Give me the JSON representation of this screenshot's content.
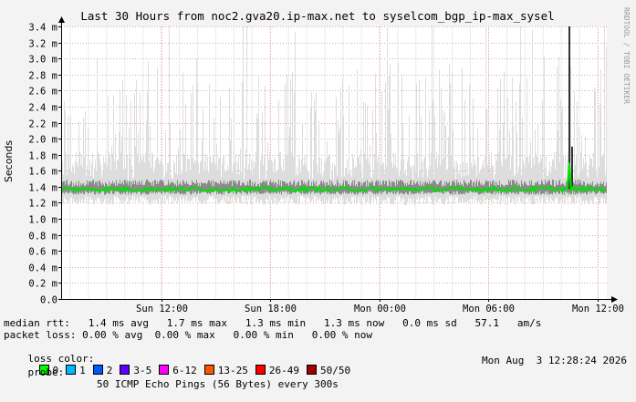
{
  "chart_data": {
    "type": "line",
    "title": "Last 30 Hours from noc2.gva20.ip-max.net to syselcom_bgp_ip-max_sysel",
    "ylabel": "Seconds",
    "watermark": "RRDTOOL / TOBI OETIKER",
    "ylim": [
      0,
      3.4
    ],
    "yticks": [
      {
        "v": 0.0,
        "label": "0.0"
      },
      {
        "v": 0.2,
        "label": "0.2 m"
      },
      {
        "v": 0.4,
        "label": "0.4 m"
      },
      {
        "v": 0.6,
        "label": "0.6 m"
      },
      {
        "v": 0.8,
        "label": "0.8 m"
      },
      {
        "v": 1.0,
        "label": "1.0 m"
      },
      {
        "v": 1.2,
        "label": "1.2 m"
      },
      {
        "v": 1.4,
        "label": "1.4 m"
      },
      {
        "v": 1.6,
        "label": "1.6 m"
      },
      {
        "v": 1.8,
        "label": "1.8 m"
      },
      {
        "v": 2.0,
        "label": "2.0 m"
      },
      {
        "v": 2.2,
        "label": "2.2 m"
      },
      {
        "v": 2.4,
        "label": "2.4 m"
      },
      {
        "v": 2.6,
        "label": "2.6 m"
      },
      {
        "v": 2.8,
        "label": "2.8 m"
      },
      {
        "v": 3.0,
        "label": "3.0 m"
      },
      {
        "v": 3.2,
        "label": "3.2 m"
      },
      {
        "v": 3.4,
        "label": "3.4 m"
      }
    ],
    "xlim": [
      0,
      30
    ],
    "xticks": [
      {
        "h": 5.5,
        "label": "Sun 12:00"
      },
      {
        "h": 11.5,
        "label": "Sun 18:00"
      },
      {
        "h": 17.5,
        "label": "Mon 00:00"
      },
      {
        "h": 23.5,
        "label": "Mon 06:00"
      },
      {
        "h": 29.5,
        "label": "Mon 12:00"
      }
    ],
    "series": [
      {
        "name": "median rtt",
        "color": "#00e000",
        "baseline_ms": 1.37
      },
      {
        "name": "smoke",
        "color": "#b0b0b0"
      }
    ]
  },
  "stats": {
    "median_rtt": "median rtt:   1.4 ms avg   1.7 ms max   1.3 ms min   1.3 ms now   0.0 ms sd   57.1   am/s",
    "packet_loss": "packet loss: 0.00 % avg  0.00 % max   0.00 % min   0.00 % now",
    "loss_color_label": "loss color:",
    "probe_label": "probe:",
    "probe_text": "50 ICMP Echo Pings (56 Bytes) every 300s",
    "timestamp": "Mon Aug  3 12:28:24 2026"
  },
  "loss_legend": [
    {
      "label": "0",
      "color": "#00ff00"
    },
    {
      "label": "1",
      "color": "#00b8ff"
    },
    {
      "label": "2",
      "color": "#0059ff"
    },
    {
      "label": "3-5",
      "color": "#5e00ff"
    },
    {
      "label": "6-12",
      "color": "#ff00ff"
    },
    {
      "label": "13-25",
      "color": "#ff5500"
    },
    {
      "label": "26-49",
      "color": "#ff0000"
    },
    {
      "label": "50/50",
      "color": "#a10000"
    }
  ]
}
